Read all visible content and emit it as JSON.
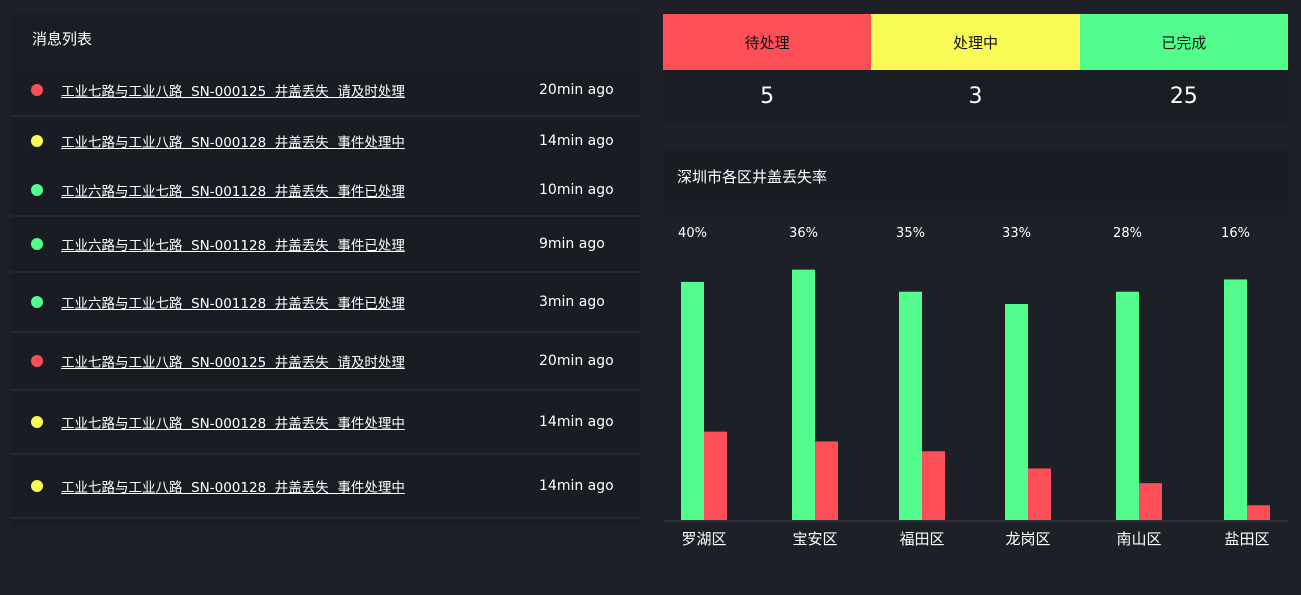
{
  "messages_panel": {
    "title": "消息列表",
    "items": [
      {
        "status": "red",
        "text": "工业七路与工业八路  SN-000125  井盖丢失  请及时处理",
        "time": "20min ago"
      },
      {
        "status": "yellow",
        "text": "工业七路与工业八路  SN-000128  井盖丢失  事件处理中",
        "time": "14min ago"
      },
      {
        "status": "green",
        "text": "工业六路与工业七路  SN-001128  井盖丢失  事件已处理",
        "time": "10min ago"
      },
      {
        "status": "green",
        "text": "工业六路与工业七路  SN-001128  井盖丢失  事件已处理",
        "time": "9min ago"
      },
      {
        "status": "green",
        "text": "工业六路与工业七路  SN-001128  井盖丢失  事件已处理",
        "time": "3min ago"
      },
      {
        "status": "red",
        "text": "工业七路与工业八路  SN-000125  井盖丢失  请及时处理",
        "time": "20min ago"
      },
      {
        "status": "yellow",
        "text": "工业七路与工业八路  SN-000128  井盖丢失  事件处理中",
        "time": "14min ago"
      },
      {
        "status": "yellow",
        "text": "工业七路与工业八路  SN-000128  井盖丢失  事件处理中",
        "time": "14min ago"
      }
    ]
  },
  "status_summary": {
    "pending": {
      "label": "待处理",
      "count": "5",
      "color": "#fe4e58"
    },
    "processing": {
      "label": "处理中",
      "count": "3",
      "color": "#fafa56"
    },
    "done": {
      "label": "已完成",
      "count": "25",
      "color": "#52fd8e"
    }
  },
  "colors": {
    "red": "#fe4e58",
    "yellow": "#fafa56",
    "green": "#52fd8e"
  },
  "chart_data": {
    "type": "bar",
    "title": "深圳市各区井盖丢失率",
    "categories": [
      "罗湖区",
      "宝安区",
      "福田区",
      "龙岗区",
      "南山区",
      "盐田区"
    ],
    "rate_labels": [
      "40%",
      "36%",
      "35%",
      "33%",
      "28%",
      "16%"
    ],
    "series": [
      {
        "color": "#52fd8e",
        "values": [
          97,
          102,
          93,
          88,
          93,
          98
        ]
      },
      {
        "color": "#fe4e58",
        "values": [
          36,
          32,
          28,
          21,
          15,
          6
        ]
      }
    ],
    "ylim": [
      0,
      110
    ],
    "grid": false,
    "legend": "none"
  }
}
